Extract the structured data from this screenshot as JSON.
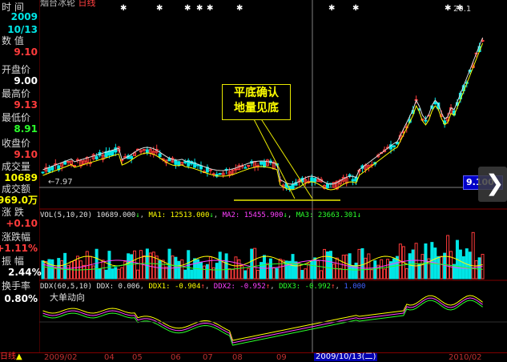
{
  "stock_name": "烟台冰轮",
  "period": "日线",
  "left_panel": [
    {
      "label": "时 间",
      "value": "2009",
      "value2": "10/13",
      "color": "#00e6e6"
    },
    {
      "label": "数 值",
      "value": "9.10",
      "color": "#ff3b3b"
    },
    {
      "label": "开盘价",
      "value": "9.00",
      "color": "#ffffff"
    },
    {
      "label": "最高价",
      "value": "9.13",
      "color": "#ff3b3b"
    },
    {
      "label": "最低价",
      "value": "8.91",
      "color": "#2bff2b"
    },
    {
      "label": "收盘价",
      "value": "9.10",
      "color": "#ff3b3b"
    },
    {
      "label": "成交量",
      "value": "10689",
      "color": "#ffff00"
    },
    {
      "label": "成交额",
      "value": "969.0万",
      "color": "#ffff00"
    },
    {
      "label": "涨 跌",
      "value": "+0.10",
      "color": "#ff3b3b"
    },
    {
      "label": "涨跌幅",
      "value": "+1.11%",
      "color": "#ff3b3b"
    },
    {
      "label": "振 幅",
      "value": "2.44%",
      "color": "#ffffff"
    },
    {
      "label": "换手率",
      "value": "0.80%",
      "color": "#ffffff"
    }
  ],
  "annotation": {
    "line1": "平底确认",
    "line2": "地量见底"
  },
  "price_marker": "9.100",
  "max_label": "20.1",
  "min_label": "7.97",
  "vol_indicator": {
    "name": "VOL(5,10,20)",
    "value": "10689.000",
    "ma1": "MA1: 12513.000",
    "ma2": "MA2: 15455.900",
    "ma3": "MA3: 23663.301",
    "colors": {
      "name": "#e0e0e0",
      "ma1": "#ffff00",
      "ma2": "#ff40ff",
      "ma3": "#2bff2b"
    }
  },
  "ddx_indicator": {
    "name": "DDX(60,5,10)",
    "ddx": "DDX: 0.006",
    "ddx1": "DDX1: -0.904",
    "ddx2": "DDX2: -0.952",
    "ddx3": "DDX3: -0.992",
    "extra": "1.000",
    "subtitle": "大单动向"
  },
  "date_axis": [
    "2009/02",
    "04",
    "05",
    "06",
    "07",
    "08",
    "09",
    "2010/02"
  ],
  "cursor_date": "2009/10/13(二)",
  "period_button": "日线",
  "colors": {
    "up": "#ff3b3b",
    "down": "#00e6e6",
    "bg": "#000000",
    "axis": "#800000"
  }
}
